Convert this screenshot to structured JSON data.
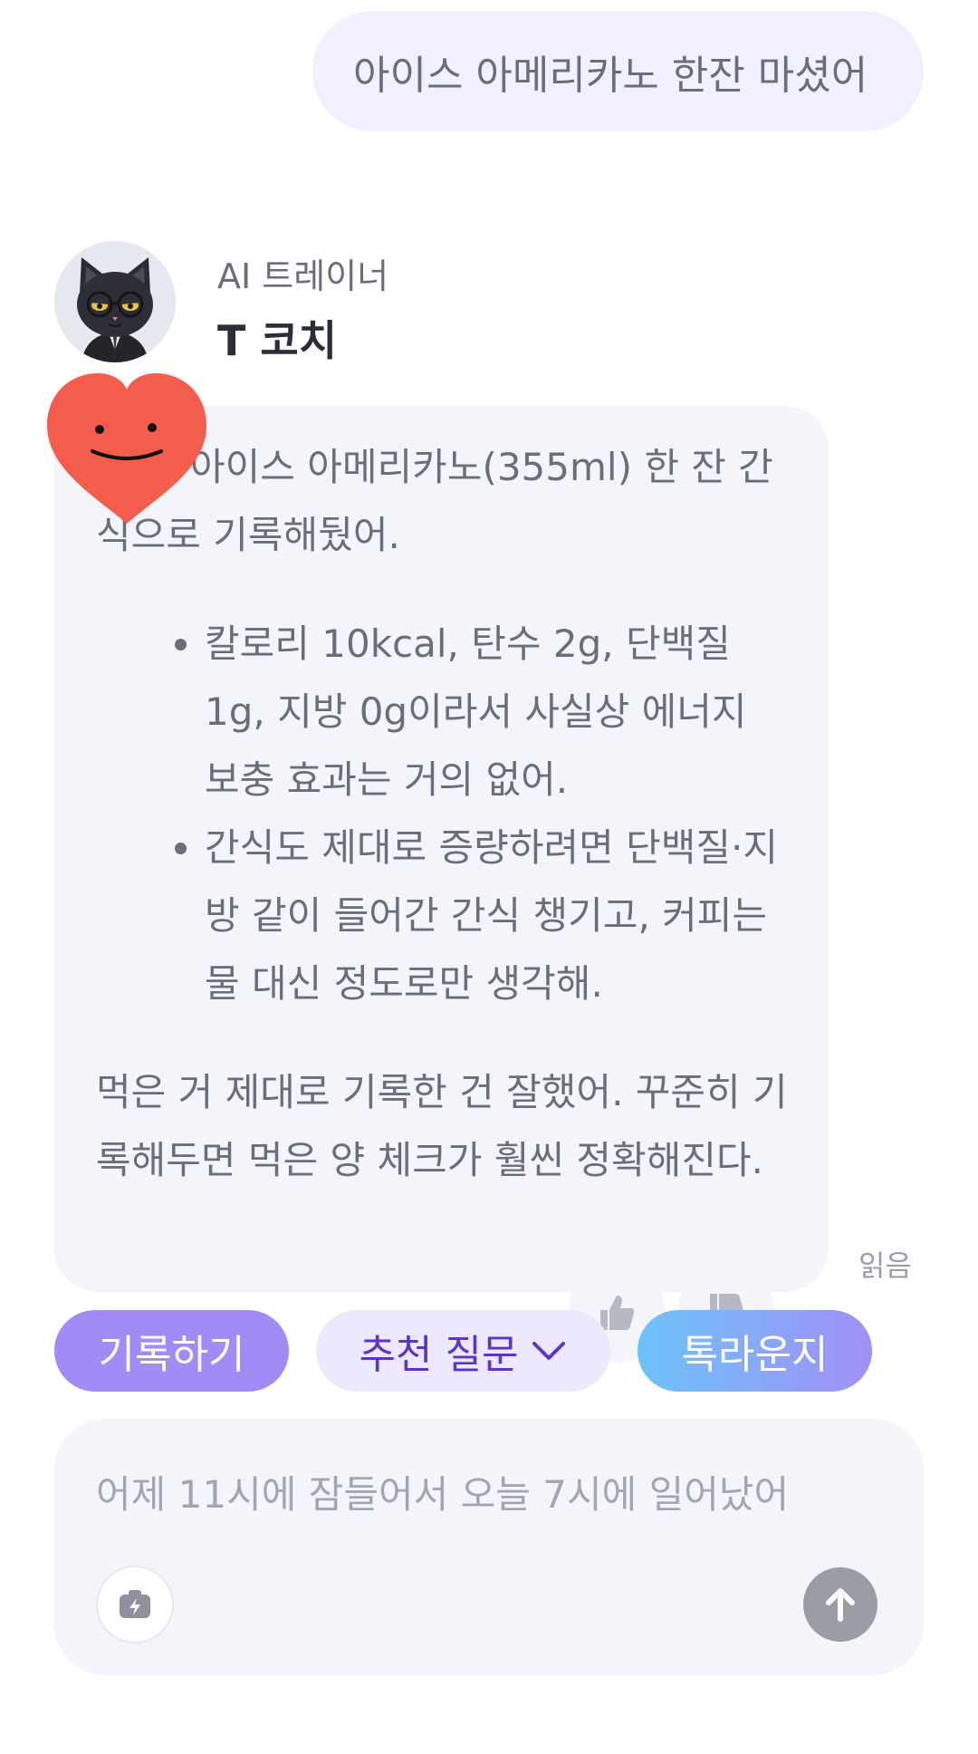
{
  "user_message": {
    "text": "아이스 아메리카노 한잔 마셨어"
  },
  "ai": {
    "role": "AI 트레이너",
    "name": "T 코치",
    "avatar_icon": "black-cat-avatar-icon",
    "sticker_icon": "smiling-heart-icon"
  },
  "ai_message": {
    "intro": "좋아, 아이스 아메리카노(355ml) 한 잔 간식으로 기록해뒀어.",
    "bullets": [
      "칼로리 10kcal, 탄수 2g, 단백질 1g, 지방 0g이라서 사실상 에너지 보충 효과는 거의 없어.",
      "간식도 제대로 증량하려면 단백질·지방 같이 들어간 간식 챙기고, 커피는 물 대신 정도로만 생각해."
    ],
    "closing": "먹은 거 제대로 기록한 건 잘했어. 꾸준히 기록해두면 먹은 양 체크가 훨씬 정확해진다.",
    "read_status": "읽음"
  },
  "reactions": {
    "like_icon": "thumbs-up-icon",
    "dislike_icon": "thumbs-down-icon"
  },
  "actions": {
    "record": "기록하기",
    "suggest": "추천 질문",
    "lounge": "톡라운지"
  },
  "input": {
    "placeholder": "어제 11시에 잠들어서 오늘 7시에 일어났어",
    "attach_icon": "camera-bolt-icon",
    "send_icon": "arrow-up-icon"
  },
  "colors": {
    "user_bubble": "#f1f0ff",
    "ai_bubble": "#f4f5fa",
    "record_chip": "#a28bf7",
    "suggest_chip": "#ede8fd",
    "suggest_text": "#5d33c8",
    "lounge_start": "#6cc3fa",
    "lounge_end": "#a18ff6",
    "heart": "#f45c4c",
    "send_button": "#9a9ca6"
  }
}
